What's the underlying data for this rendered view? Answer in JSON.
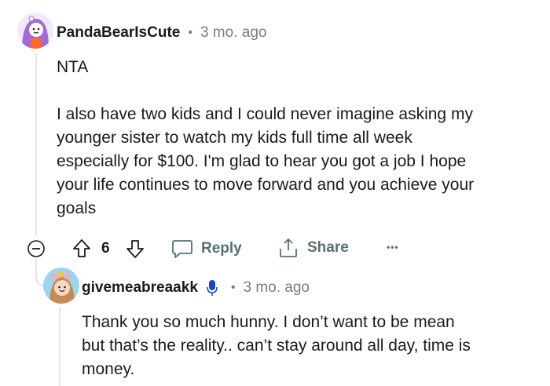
{
  "comment": {
    "username": "PandaBearIsCute",
    "separator": "•",
    "time": "3 mo. ago",
    "paragraphs": [
      "NTA",
      "I also have two kids and I could never imagine asking my",
      "younger sister to watch my kids full time all week",
      "especially for $100. I'm glad to hear you got a job I hope",
      "your life continues to move forward and you achieve your",
      "goals"
    ],
    "vote_count": "6",
    "reply_label": "Reply",
    "share_label": "Share",
    "more_label": "•••"
  },
  "reply": {
    "username": "givemeabreaakk",
    "separator": "•",
    "time": "3 mo. ago",
    "lines": [
      "Thank you so much hunny. I don’t want to be mean",
      "but that’s the reality.. can’t stay around all day, time is",
      "money."
    ]
  },
  "colors": {
    "text": "#1a1a1b",
    "meta": "#7c7c7c",
    "action": "#576f76",
    "avatar_purple": "#a26bd6",
    "reply_avatar_bg": "#9fd5ec",
    "mic_blue": "#1a4bb5"
  }
}
